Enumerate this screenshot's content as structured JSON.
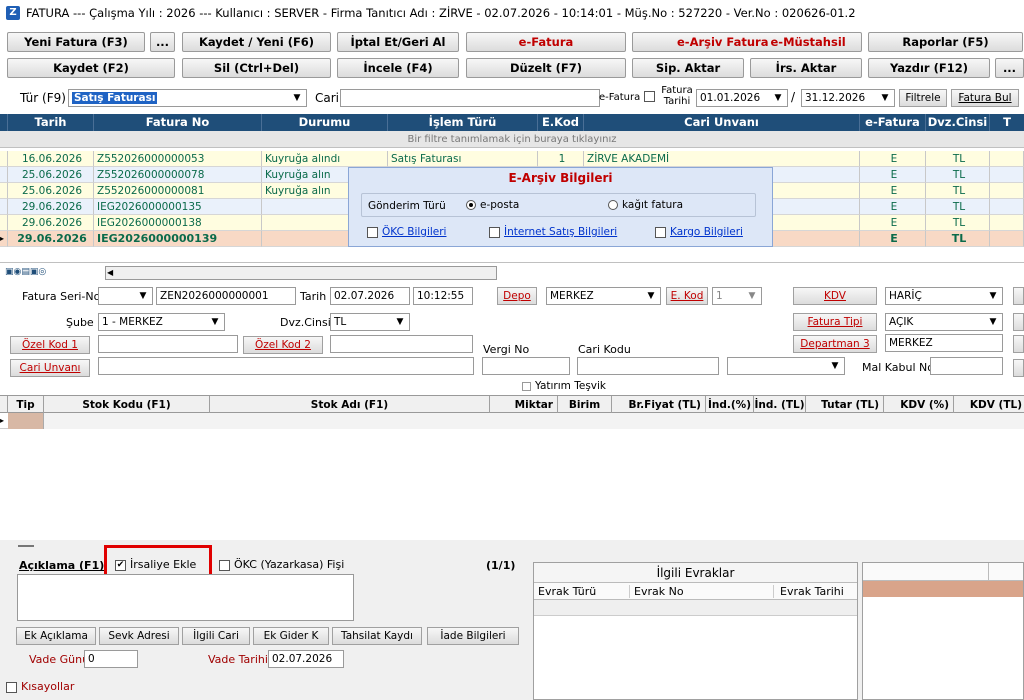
{
  "title": "FATURA  ---  Çalışma Yılı : 2026  ---  Kullanıcı : SERVER - Firma Tanıtıcı Adı : ZİRVE - 02.07.2026 - 10:14:01 - Müş.No : 527220 - Ver.No : 020626-01.2",
  "toolbar": {
    "row1": [
      "Yeni Fatura (F3)",
      "...",
      "Kaydet / Yeni (F6)",
      "İptal Et/Geri Al",
      "e-Fatura",
      "e-Arşiv Fatura",
      "e-Müstahsil",
      "Raporlar (F5)"
    ],
    "row2": [
      "Kaydet (F2)",
      "Sil (Ctrl+Del)",
      "İncele (F4)",
      "Düzelt (F7)",
      "Sip. Aktar",
      "İrs. Aktar",
      "Yazdır (F12)",
      "..."
    ]
  },
  "filter": {
    "tur_label": "Tür (F9)",
    "tur_value": "Satış Faturası",
    "cari_label": "Cari",
    "efatura_label": "e-Fatura",
    "fatura_tarihi_label": "Fatura Tarihi",
    "date_from": "01.01.2026",
    "sep": "/",
    "date_to": "31.12.2026",
    "filtrele": "Filtrele",
    "fatura_bul": "Fatura Bul"
  },
  "grid": {
    "headers": [
      "Tarih",
      "Fatura No",
      "Durumu",
      "İşlem Türü",
      "E.Kod",
      "Cari Unvanı",
      "e-Fatura",
      "Dvz.Cinsi",
      "T"
    ],
    "filter_hint": "Bir filtre tanımlamak için buraya tıklayınız",
    "rows": [
      {
        "tarih": "16.06.2026",
        "no": "Z552026000000053",
        "durum": "Kuyruğa alındı",
        "islem": "Satış Faturası",
        "ekod": "1",
        "cari": "ZİRVE AKADEMİ",
        "ef": "E",
        "dvz": "TL"
      },
      {
        "tarih": "25.06.2026",
        "no": "Z552026000000078",
        "durum": "Kuyruğa alın",
        "islem": "",
        "ekod": "",
        "cari": "",
        "ef": "E",
        "dvz": "TL"
      },
      {
        "tarih": "25.06.2026",
        "no": "Z552026000000081",
        "durum": "Kuyruğa alın",
        "islem": "",
        "ekod": "",
        "cari": "",
        "ef": "E",
        "dvz": "TL"
      },
      {
        "tarih": "29.06.2026",
        "no": "IEG2026000000135",
        "durum": "",
        "islem": "",
        "ekod": "",
        "cari": "",
        "ef": "E",
        "dvz": "TL"
      },
      {
        "tarih": "29.06.2026",
        "no": "IEG2026000000138",
        "durum": "",
        "islem": "",
        "ekod": "",
        "cari": "",
        "ef": "E",
        "dvz": "TL"
      },
      {
        "tarih": "29.06.2026",
        "no": "IEG2026000000139",
        "durum": "",
        "islem": "",
        "ekod": "",
        "cari": "",
        "ef": "E",
        "dvz": "TL"
      }
    ]
  },
  "popup": {
    "title": "E-Arşiv Bilgileri",
    "gonderim_label": "Gönderim Türü",
    "opt1": "e-posta",
    "opt2": "kağıt fatura",
    "link1": "ÖKC Bilgileri",
    "link2": "İnternet Satış Bilgileri",
    "link3": "Kargo Bilgileri"
  },
  "form": {
    "seri_no_label": "Fatura Seri-No",
    "seri_no_value": "ZEN2026000000001",
    "tarih_label": "Tarih",
    "tarih_value": "02.07.2026",
    "saat_value": "10:12:55",
    "depo_label": "Depo",
    "depo_value": "MERKEZ",
    "ekod_label": "E. Kod",
    "ekod_value": "1",
    "kdv_label": "KDV",
    "kdv_value": "HARİÇ",
    "sube_label": "Şube",
    "sube_value": "1 - MERKEZ",
    "dvz_label": "Dvz.Cinsi",
    "dvz_value": "TL",
    "fatura_tipi_label": "Fatura Tipi",
    "fatura_tipi_value": "AÇIK",
    "ozel_kod1": "Özel Kod 1",
    "ozel_kod2": "Özel Kod 2",
    "departman_label": "Departman 3",
    "departman_value": "MERKEZ",
    "vergi_no_label": "Vergi No",
    "cari_kodu_label": "Cari Kodu",
    "cari_unvani_label": "Cari Unvanı",
    "mal_kabul_label": "Mal Kabul No",
    "yatirim_label": "Yatırım Teşvik"
  },
  "items": {
    "headers": [
      "Tip",
      "Stok Kodu (F1)",
      "Stok Adı (F1)",
      "Miktar",
      "Birim",
      "Br.Fiyat (TL)",
      "İnd.(%)",
      "İnd. (TL)",
      "Tutar (TL)",
      "KDV (%)",
      "KDV (TL)"
    ]
  },
  "bottom": {
    "aciklama_label": "Açıklama (F1)",
    "irsaliye_label": "İrsaliye Ekle",
    "okc_label": "ÖKC (Yazarkasa) Fişi",
    "page": "(1/1)",
    "buttons": [
      "Ek Açıklama",
      "Sevk Adresi",
      "İlgili Cari",
      "Ek Gider K",
      "Tahsilat Kaydı",
      "İade Bilgileri"
    ],
    "vade_gunu_label": "Vade Günü",
    "vade_gunu_value": "0",
    "vade_tarihi_label": "Vade Tarihi",
    "vade_tarihi_value": "02.07.2026",
    "kisayollar_label": "Kısayollar",
    "ilgili_title": "İlgili Evraklar",
    "ilgili_headers": [
      "Evrak Türü",
      "Evrak No",
      "Evrak Tarihi"
    ]
  },
  "colors": {
    "header_bg": "#1f4e79",
    "accent_red": "#c00000",
    "highlight_box": "#e00000",
    "row_yellow": "#fffde0",
    "row_blue": "#eaf1fb",
    "selected_row": "#f8d9c5"
  }
}
